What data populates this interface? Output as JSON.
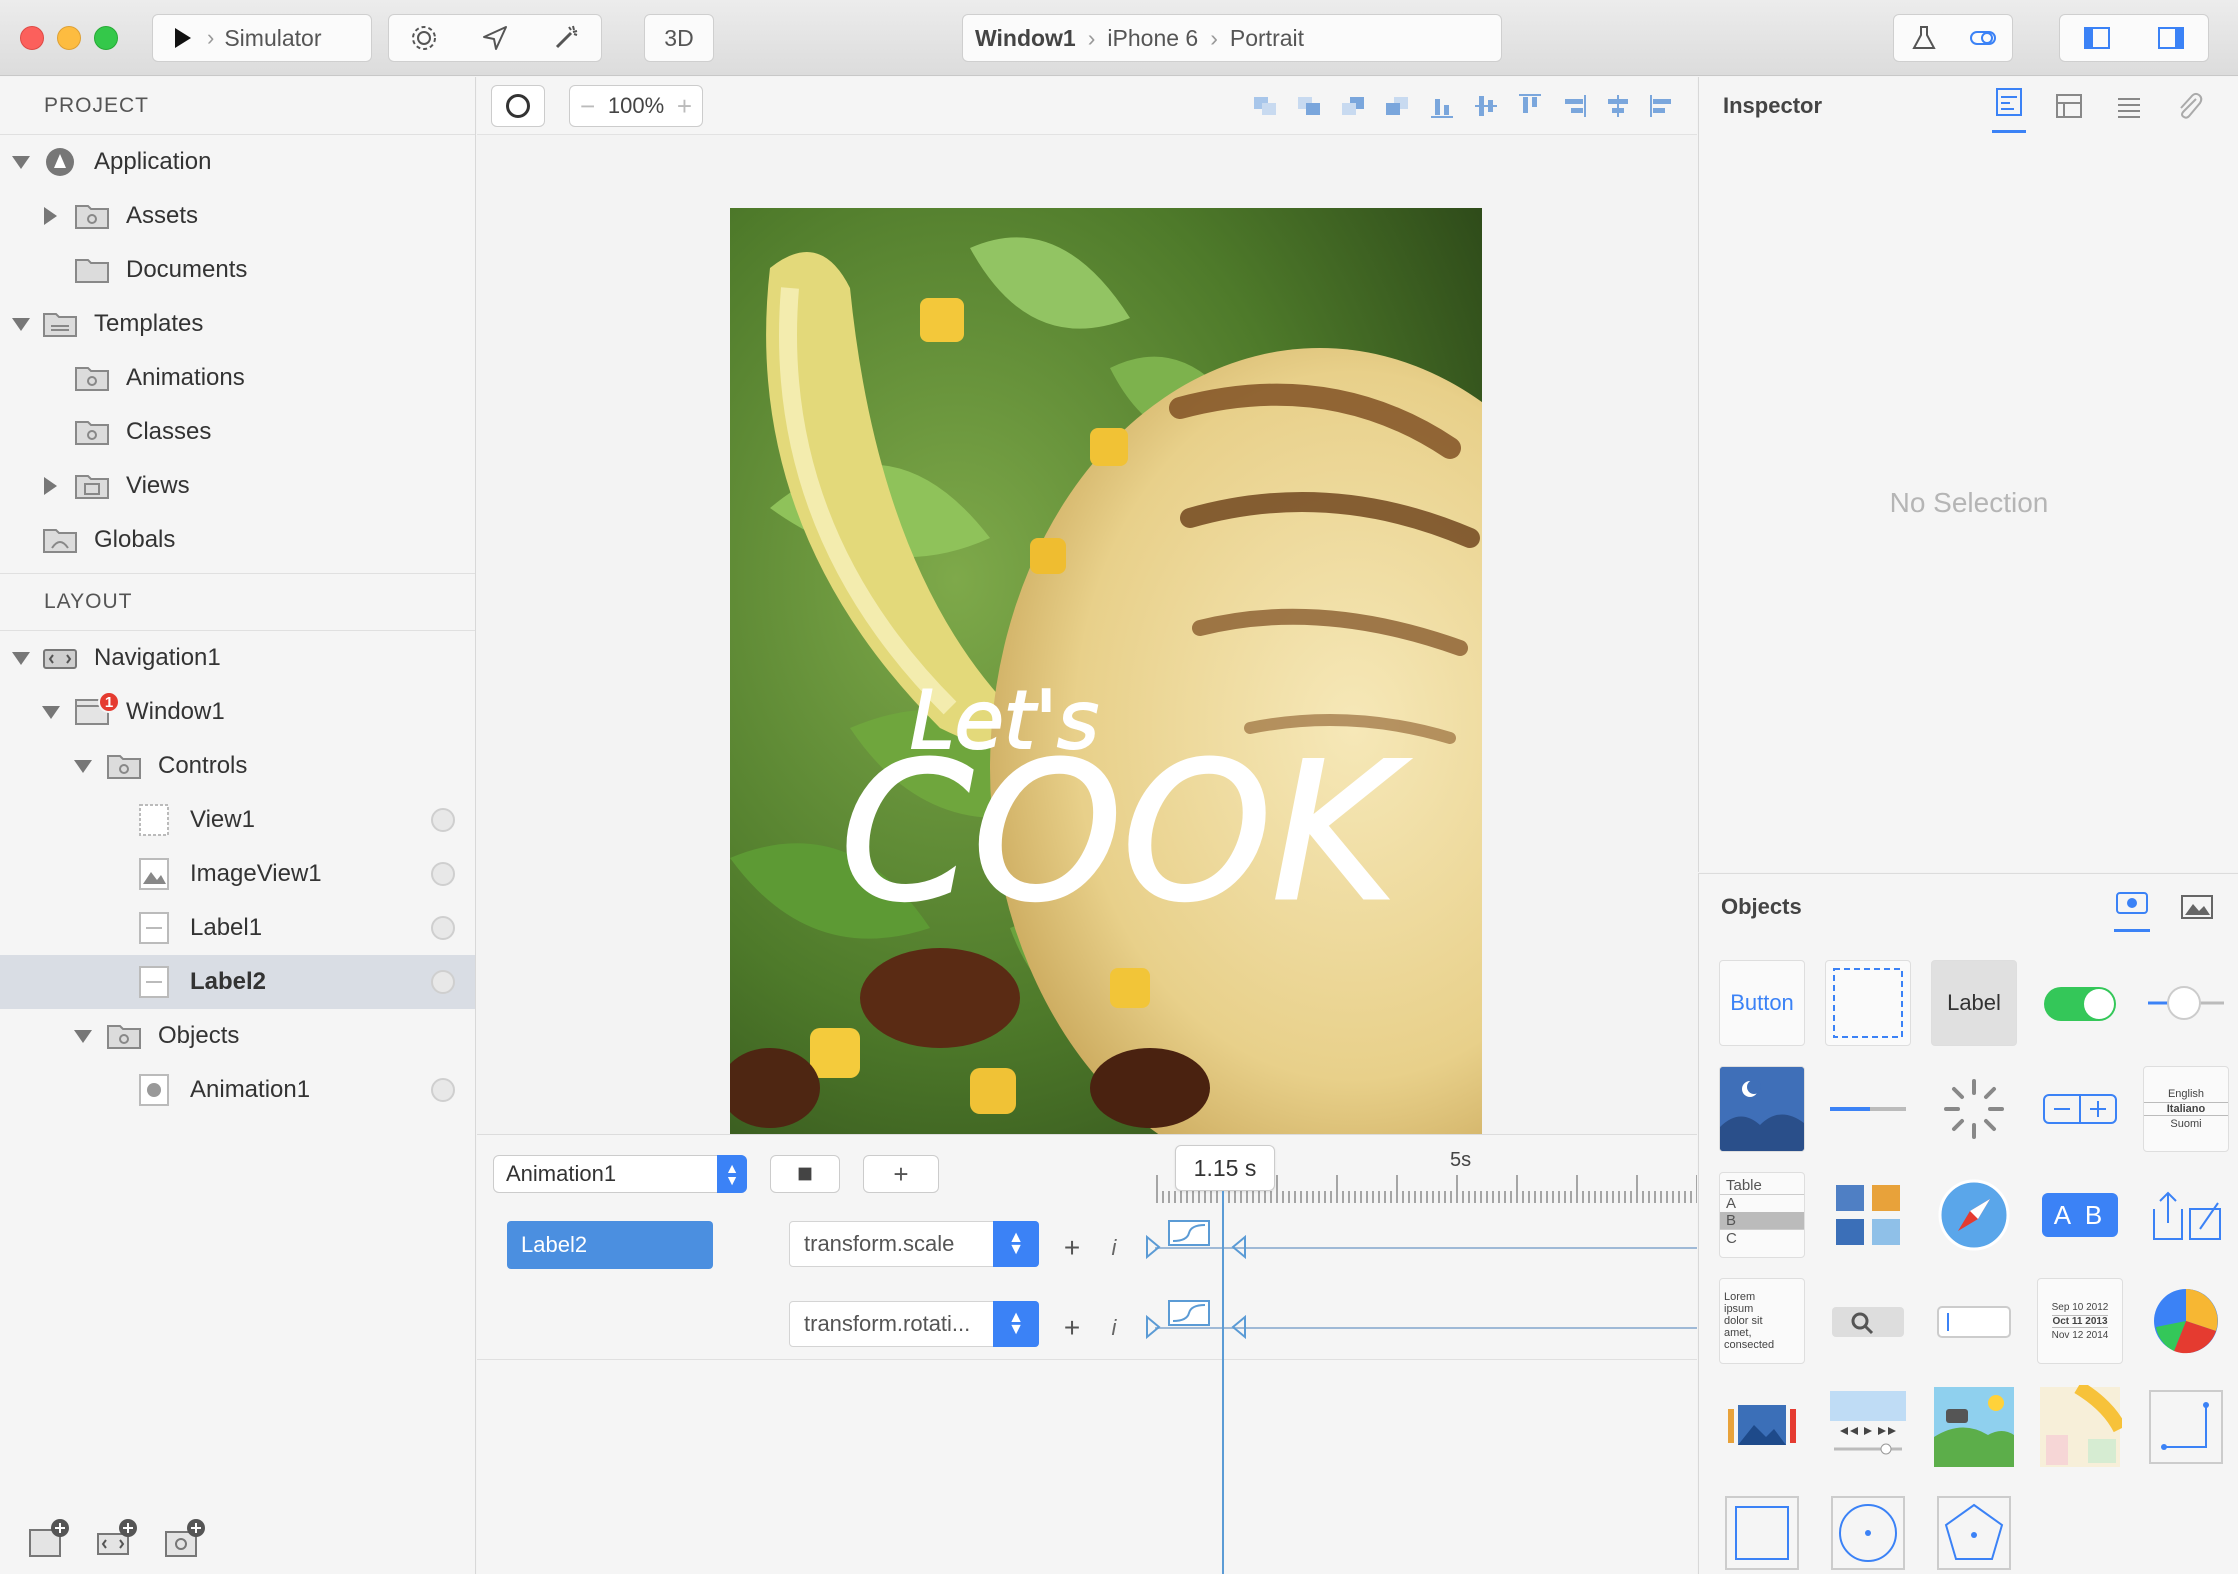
{
  "toolbar": {
    "run_target": "Simulator",
    "btn_3d": "3D",
    "breadcrumb": [
      "Window1",
      "iPhone 6",
      "Portrait"
    ]
  },
  "sidebar": {
    "project_header": "PROJECT",
    "project_items": [
      {
        "label": "Application",
        "icon": "application-icon"
      },
      {
        "label": "Assets",
        "icon": "folder-icon"
      },
      {
        "label": "Documents",
        "icon": "folder-icon"
      },
      {
        "label": "Templates",
        "icon": "folder-icon"
      },
      {
        "label": "Animations",
        "icon": "folder-icon"
      },
      {
        "label": "Classes",
        "icon": "folder-icon"
      },
      {
        "label": "Views",
        "icon": "folder-icon"
      },
      {
        "label": "Globals",
        "icon": "folder-icon"
      }
    ],
    "layout_header": "LAYOUT",
    "layout_items": [
      {
        "label": "Navigation1"
      },
      {
        "label": "Window1",
        "badge": "1"
      },
      {
        "label": "Controls"
      },
      {
        "label": "View1"
      },
      {
        "label": "ImageView1"
      },
      {
        "label": "Label1"
      },
      {
        "label": "Label2"
      },
      {
        "label": "Objects"
      },
      {
        "label": "Animation1"
      }
    ]
  },
  "canvas": {
    "zoom": "100%",
    "overlay_text_1": "Let's",
    "overlay_text_2": "COOK"
  },
  "animation": {
    "selected": "Animation1",
    "time": "1.15 s",
    "ruler_mark": "5s",
    "layer": "Label2",
    "tracks": [
      {
        "property": "transform.scale"
      },
      {
        "property": "transform.rotati..."
      }
    ]
  },
  "inspector": {
    "title": "Inspector",
    "empty": "No Selection"
  },
  "objects": {
    "title": "Objects",
    "items": {
      "button_label": "Button",
      "label_label": "Label",
      "table_rows": [
        "Table",
        "A",
        "B",
        "C"
      ],
      "lorem": [
        "Lorem",
        "ipsum",
        "dolor sit",
        "amet,",
        "consected"
      ],
      "picker_langs": [
        "English",
        "Italiano",
        "Suomi"
      ],
      "date_rows": [
        "Sep 10 2012",
        "Oct 11 2013",
        "Nov 12 2014"
      ],
      "ab_label": "A B"
    }
  },
  "colors": {
    "accent": "#3b82f6",
    "badge": "#e53b30",
    "switch_on": "#34c759"
  }
}
